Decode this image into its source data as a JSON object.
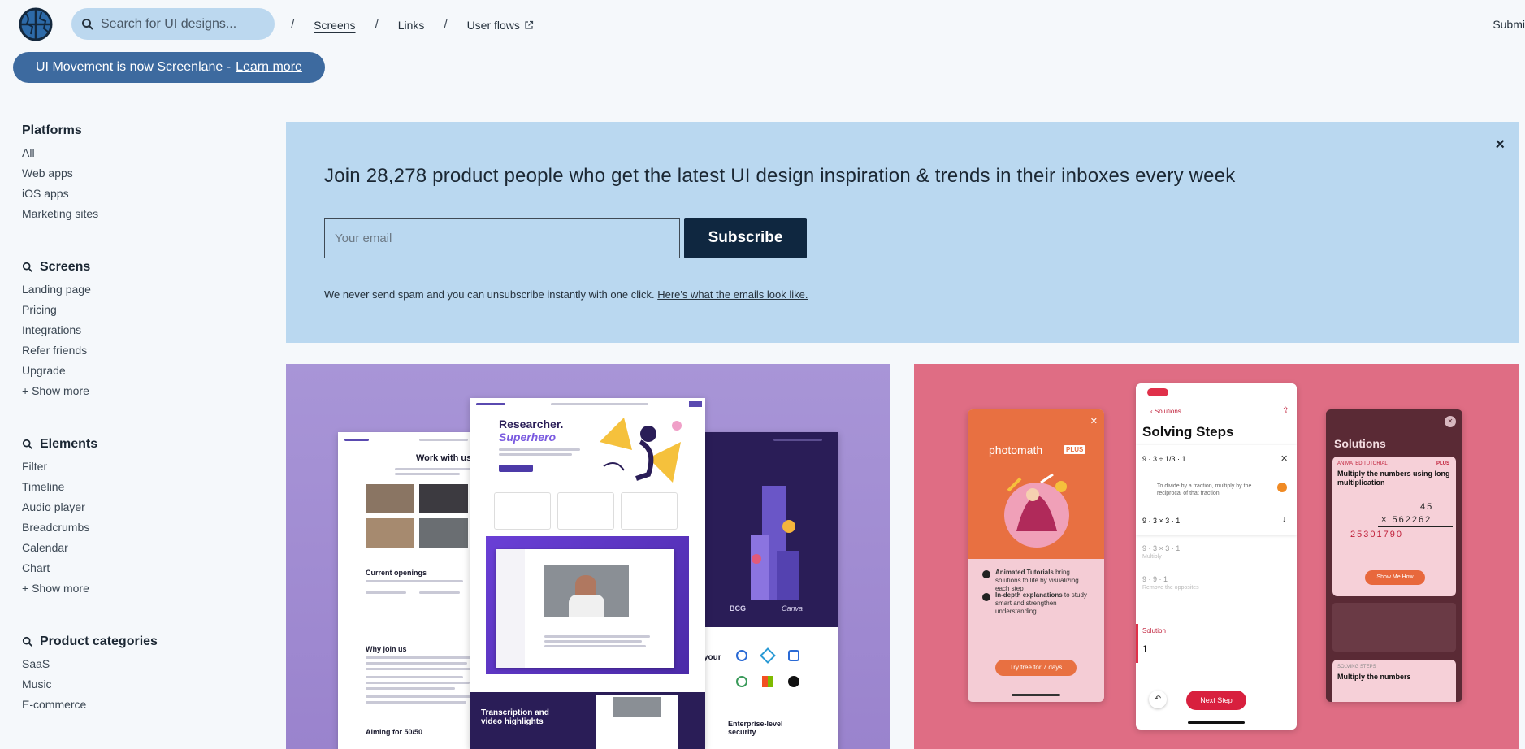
{
  "header": {
    "search_placeholder": "Search for UI designs...",
    "crumbs": [
      "Screens",
      "Links",
      "User flows"
    ],
    "submit": "Submi"
  },
  "notice": {
    "text": "UI Movement is now Screenlane -",
    "link": "Learn more"
  },
  "sidebar": {
    "platforms": {
      "title": "Platforms",
      "items": [
        "All",
        "Web apps",
        "iOS apps",
        "Marketing sites"
      ]
    },
    "screens": {
      "title": "Screens",
      "items": [
        "Landing page",
        "Pricing",
        "Integrations",
        "Refer friends",
        "Upgrade",
        "+ Show more"
      ]
    },
    "elements": {
      "title": "Elements",
      "items": [
        "Filter",
        "Timeline",
        "Audio player",
        "Breadcrumbs",
        "Calendar",
        "Chart",
        "+ Show more"
      ]
    },
    "categories": {
      "title": "Product categories",
      "items": [
        "SaaS",
        "Music",
        "E-commerce"
      ]
    }
  },
  "newsletter": {
    "title": "Join 28,278 product people who get the latest UI design inspiration & trends in their inboxes every week",
    "email_placeholder": "Your email",
    "button": "Subscribe",
    "note": "We never send spam and you can unsubscribe instantly with one click.",
    "note_link": "Here's what the emails look like.",
    "close": "×"
  },
  "card_a": {
    "hero_title": "Researcher.",
    "hero_title_2": "Superhero",
    "work_title": "Work with us",
    "openings": "Current openings",
    "why_join": "Why join us",
    "aiming": "Aiming for 50/50",
    "transcription": "Transcription and video highlights",
    "your": "your",
    "enterprise": "Enterprise-level security",
    "logo_bcg": "BCG",
    "logo_canva": "Canva"
  },
  "card_b": {
    "photomath": "photomath",
    "plus": "PLUS",
    "feature_1_bold": "Animated Tutorials",
    "feature_1": " bring solutions to life by visualizing each step",
    "feature_2_bold": "In-depth explanations",
    "feature_2": " to study smart and strengthen understanding",
    "trial": "Try free for 7 days",
    "back": "Solutions",
    "steps_title": "Solving Steps",
    "expr_1": "9 · 3 ÷ 1/3 · 1",
    "hint": "To divide by a fraction, multiply by the reciprocal of that fraction",
    "hint_link": "reciprocal",
    "expr_2": "9 · 3 × 3 · 1",
    "expr_3": "9 · 3 × 3 · 1",
    "multiply": "Multiply",
    "expr_4": "9 · 9 · 1",
    "remove": "Remove the opposites",
    "solution_label": "Solution",
    "solution_value": "1",
    "next_step": "Next Step",
    "solutions": "Solutions",
    "animated_tutorial": "ANIMATED TUTORIAL",
    "plus_2": "PLUS",
    "multiply_title": "Multiply the numbers using long multiplication",
    "num_top": "45",
    "num_mid": "× 562262",
    "num_res": "25301790",
    "show_me": "Show Me How",
    "solving_steps": "SOLVING STEPS",
    "multiply_2": "Multiply the numbers"
  }
}
